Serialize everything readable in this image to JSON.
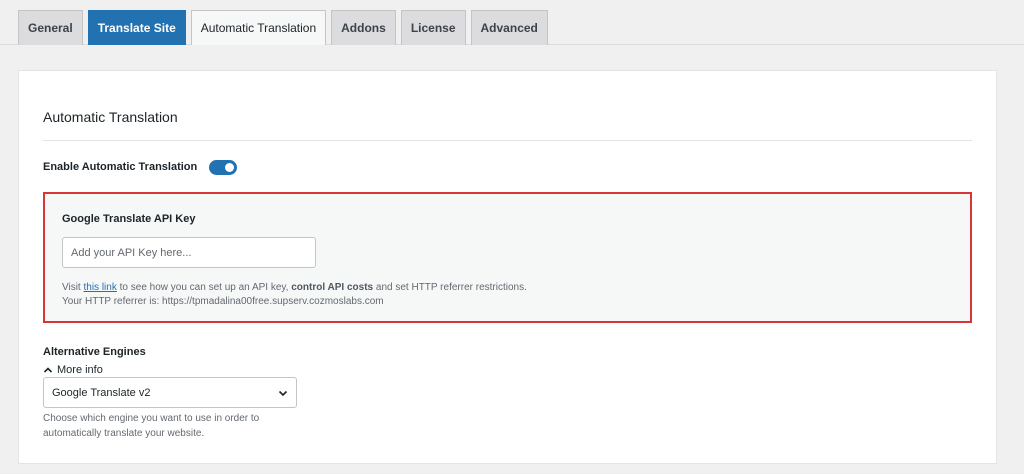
{
  "tabs": [
    {
      "label": "General",
      "state": "default"
    },
    {
      "label": "Translate Site",
      "state": "highlighted"
    },
    {
      "label": "Automatic Translation",
      "state": "current"
    },
    {
      "label": "Addons",
      "state": "default"
    },
    {
      "label": "License",
      "state": "default"
    },
    {
      "label": "Advanced",
      "state": "default"
    }
  ],
  "section": {
    "title": "Automatic Translation"
  },
  "enable": {
    "label": "Enable Automatic Translation",
    "enabled": true
  },
  "api_key": {
    "title": "Google Translate API Key",
    "placeholder": "Add your API Key here...",
    "value": "",
    "help_prefix": "Visit ",
    "help_link": "this link",
    "help_middle": " to see how you can set up an API key, ",
    "help_bold": "control API costs",
    "help_suffix": " and set HTTP referrer restrictions.",
    "referrer_text": "Your HTTP referrer is: https://tpmadalina00free.supserv.cozmoslabs.com"
  },
  "alternative_engines": {
    "title": "Alternative Engines",
    "more_info": "More info",
    "selected": "Google Translate v2",
    "help": "Choose which engine you want to use in order to automatically translate your website."
  },
  "colors": {
    "accent": "#2271b1",
    "highlight_border": "#d63638"
  }
}
